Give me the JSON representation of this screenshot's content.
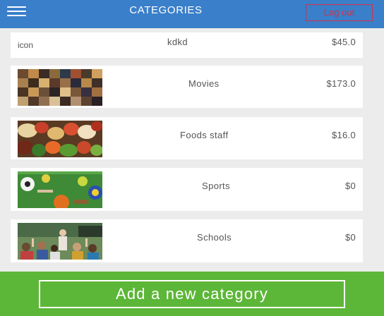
{
  "header": {
    "title": "CATEGORIES",
    "logout_label": "Log out",
    "menu_icon": "hamburger-menu-icon"
  },
  "categories": [
    {
      "name": "kdkd",
      "price": "$45.0",
      "image_text": "icon"
    },
    {
      "name": "Movies",
      "price": "$173.0"
    },
    {
      "name": "Foods staff",
      "price": "$16.0"
    },
    {
      "name": "Sports",
      "price": "$0"
    },
    {
      "name": "Schools",
      "price": "$0"
    }
  ],
  "footer": {
    "add_label": "Add a new category"
  },
  "colors": {
    "header": "#3a7fc9",
    "logout": "#d6304a",
    "footer": "#5cb638",
    "background": "#ececec"
  }
}
